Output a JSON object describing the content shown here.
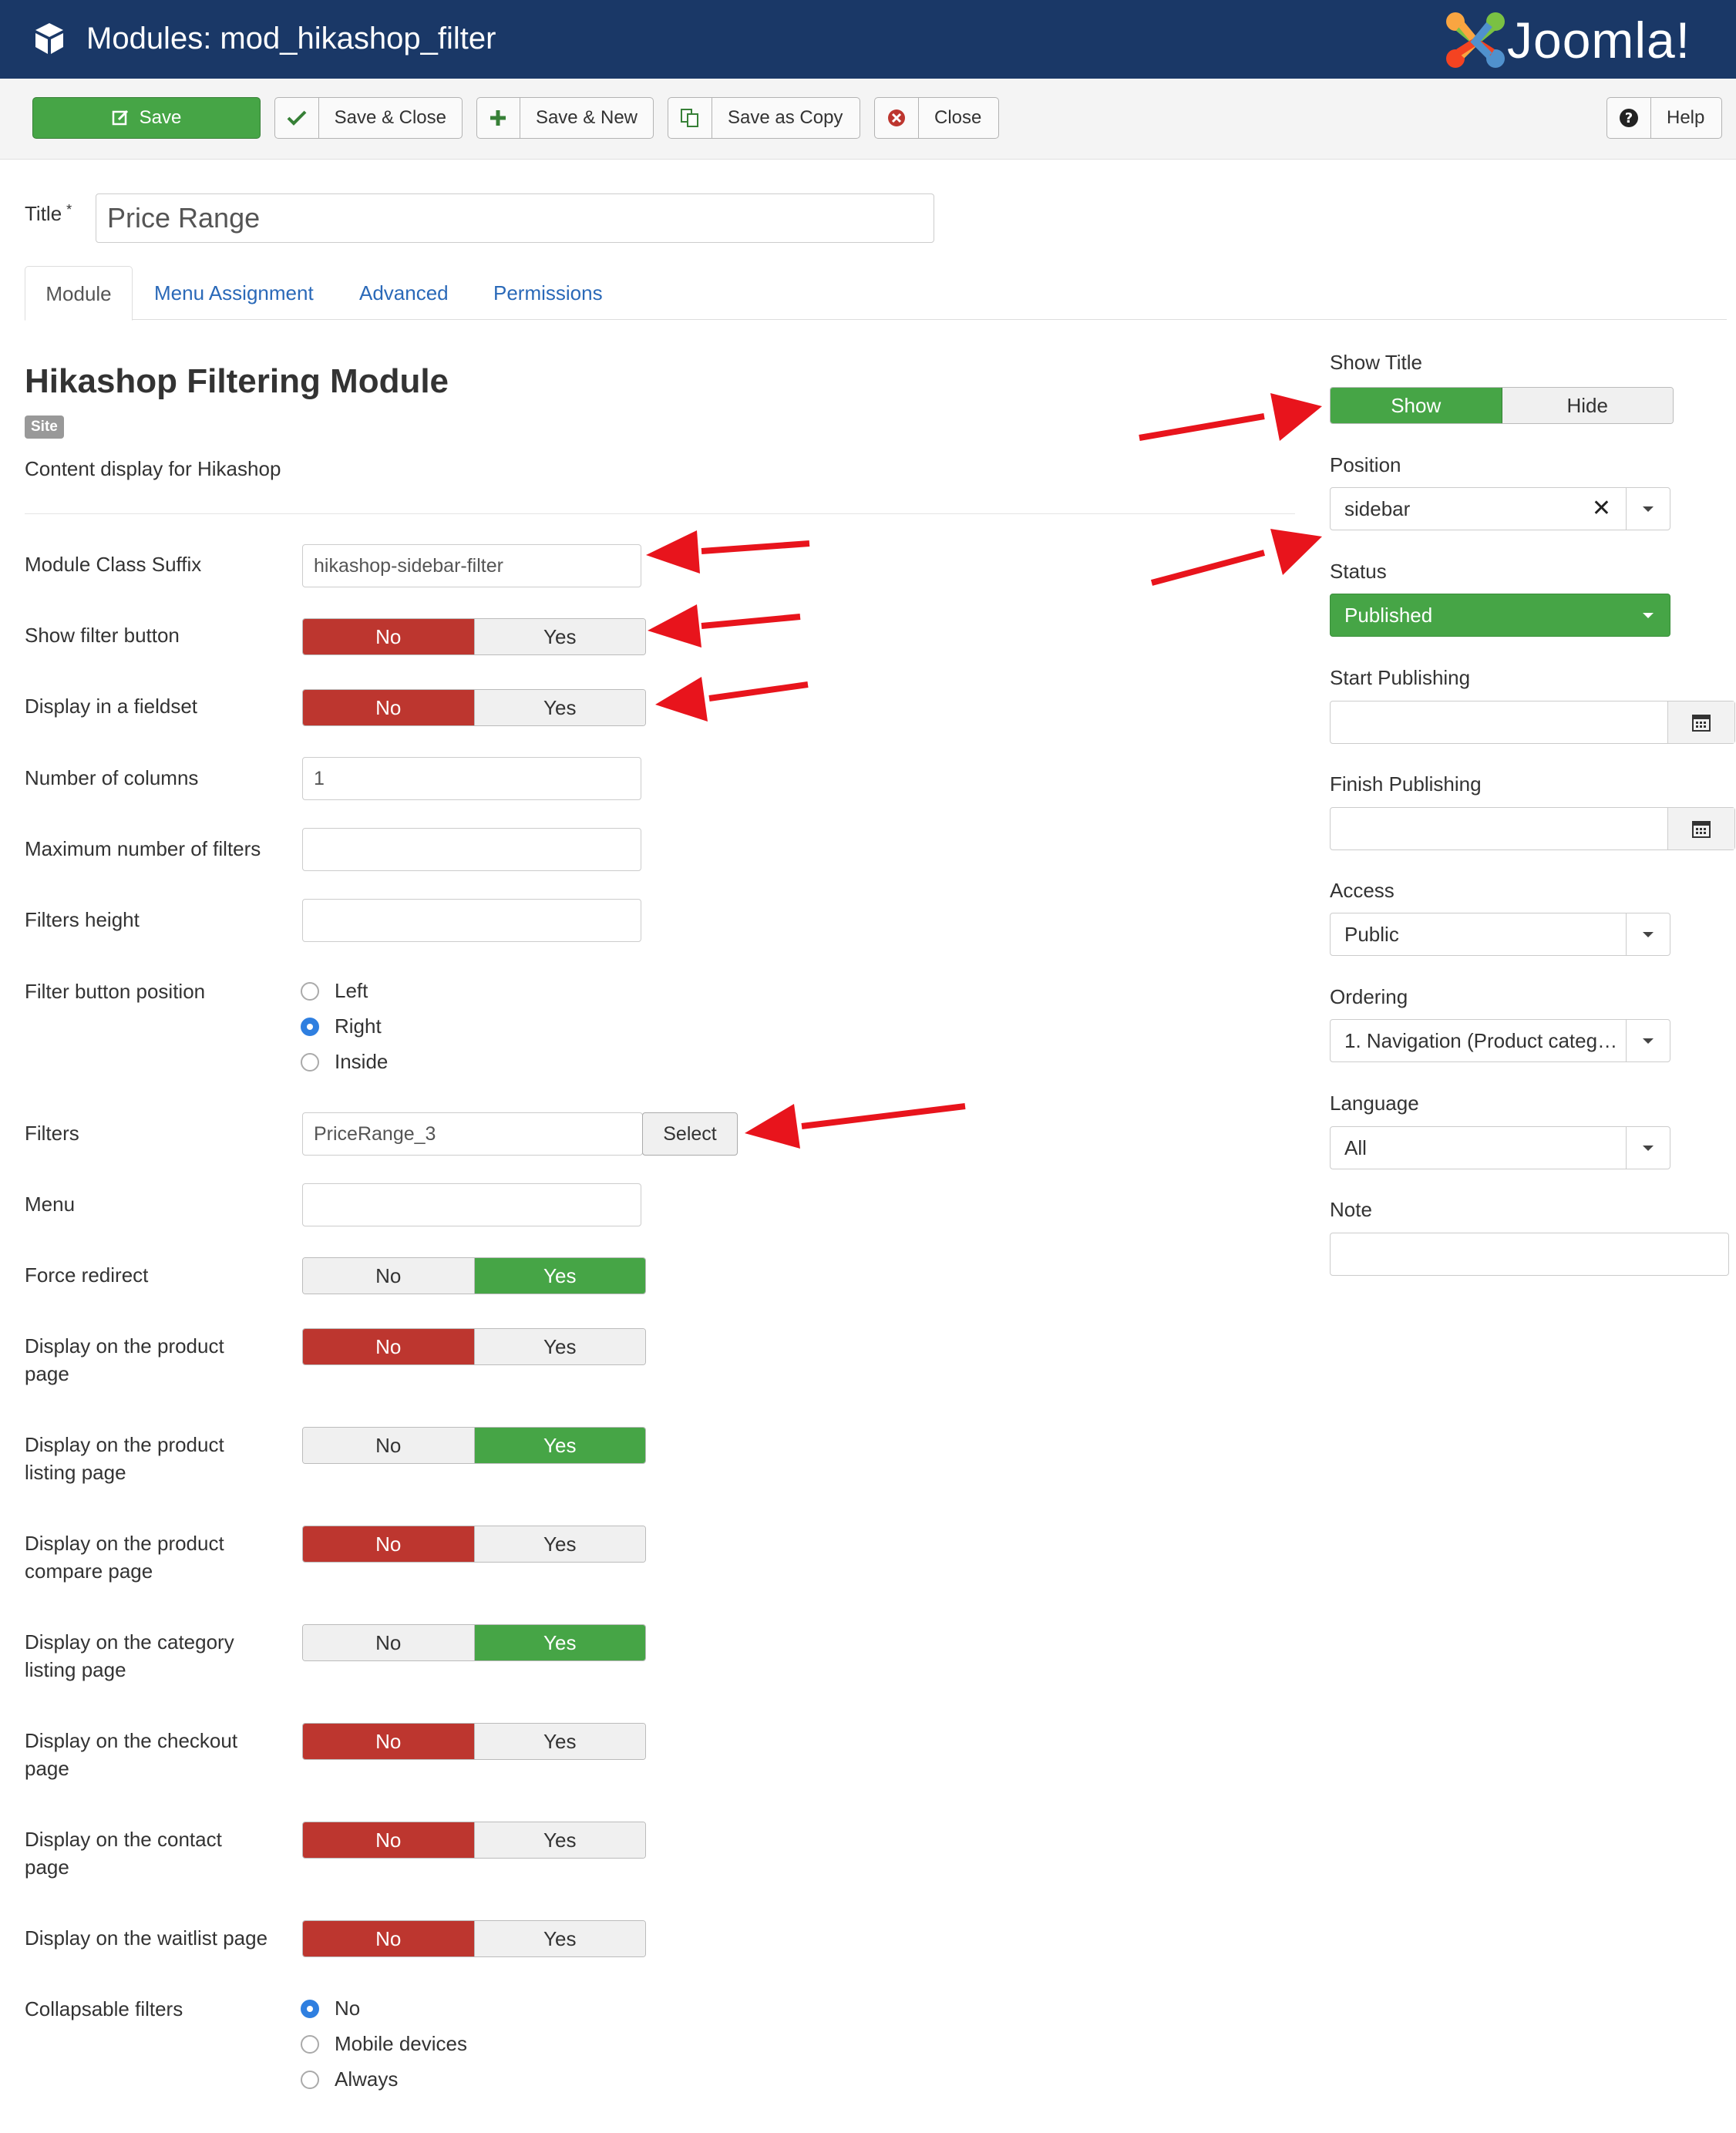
{
  "header": {
    "title": "Modules: mod_hikashop_filter",
    "brand": "Joomla!"
  },
  "toolbar": {
    "save": "Save",
    "save_close": "Save & Close",
    "save_new": "Save & New",
    "save_copy": "Save as Copy",
    "close": "Close",
    "help": "Help"
  },
  "title_field": {
    "label": "Title",
    "required_mark": "*",
    "value": "Price Range"
  },
  "tabs": [
    "Module",
    "Menu Assignment",
    "Advanced",
    "Permissions"
  ],
  "module": {
    "heading": "Hikashop Filtering Module",
    "badge": "Site",
    "description": "Content display for Hikashop"
  },
  "form": {
    "class_suffix": {
      "label": "Module Class Suffix",
      "value": "hikashop-sidebar-filter"
    },
    "show_filter_button": {
      "label": "Show filter button",
      "no": "No",
      "yes": "Yes",
      "selected": "No"
    },
    "display_fieldset": {
      "label": "Display in a fieldset",
      "no": "No",
      "yes": "Yes",
      "selected": "No"
    },
    "columns": {
      "label": "Number of columns",
      "value": "1"
    },
    "max_filters": {
      "label": "Maximum number of filters",
      "value": ""
    },
    "filters_height": {
      "label": "Filters height",
      "value": ""
    },
    "filter_button_position": {
      "label": "Filter button position",
      "options": [
        "Left",
        "Right",
        "Inside"
      ],
      "selected": "Right"
    },
    "filters": {
      "label": "Filters",
      "value": "PriceRange_3",
      "button": "Select"
    },
    "menu": {
      "label": "Menu",
      "value": ""
    },
    "force_redirect": {
      "label": "Force redirect",
      "no": "No",
      "yes": "Yes",
      "selected": "Yes"
    },
    "product_page": {
      "label_1": "Display on the product",
      "label_2": "page",
      "no": "No",
      "yes": "Yes",
      "selected": "No"
    },
    "product_listing": {
      "label_1": "Display on the product",
      "label_2": "listing page",
      "no": "No",
      "yes": "Yes",
      "selected": "Yes"
    },
    "product_compare": {
      "label_1": "Display on the product",
      "label_2": "compare page",
      "no": "No",
      "yes": "Yes",
      "selected": "No"
    },
    "category_listing": {
      "label_1": "Display on the category",
      "label_2": "listing page",
      "no": "No",
      "yes": "Yes",
      "selected": "Yes"
    },
    "checkout_page": {
      "label_1": "Display on the checkout",
      "label_2": "page",
      "no": "No",
      "yes": "Yes",
      "selected": "No"
    },
    "contact_page": {
      "label_1": "Display on the contact",
      "label_2": "page",
      "no": "No",
      "yes": "Yes",
      "selected": "No"
    },
    "waitlist_page": {
      "label": "Display on the waitlist page",
      "no": "No",
      "yes": "Yes",
      "selected": "No"
    },
    "collapsable": {
      "label": "Collapsable filters",
      "options": [
        "No",
        "Mobile devices",
        "Always"
      ],
      "selected": "No"
    }
  },
  "sidebar": {
    "show_title": {
      "label": "Show Title",
      "show": "Show",
      "hide": "Hide",
      "selected": "Show"
    },
    "position": {
      "label": "Position",
      "value": "sidebar"
    },
    "status": {
      "label": "Status",
      "value": "Published"
    },
    "start_publishing": {
      "label": "Start Publishing",
      "value": ""
    },
    "finish_publishing": {
      "label": "Finish Publishing",
      "value": ""
    },
    "access": {
      "label": "Access",
      "value": "Public"
    },
    "ordering": {
      "label": "Ordering",
      "value": "1. Navigation (Product categ…"
    },
    "language": {
      "label": "Language",
      "value": "All"
    },
    "note": {
      "label": "Note",
      "value": ""
    }
  },
  "colors": {
    "header_bg": "#1a3867",
    "green": "#46a546",
    "red": "#bd362f",
    "link": "#2a69b8",
    "arrow": "#e8141c"
  }
}
